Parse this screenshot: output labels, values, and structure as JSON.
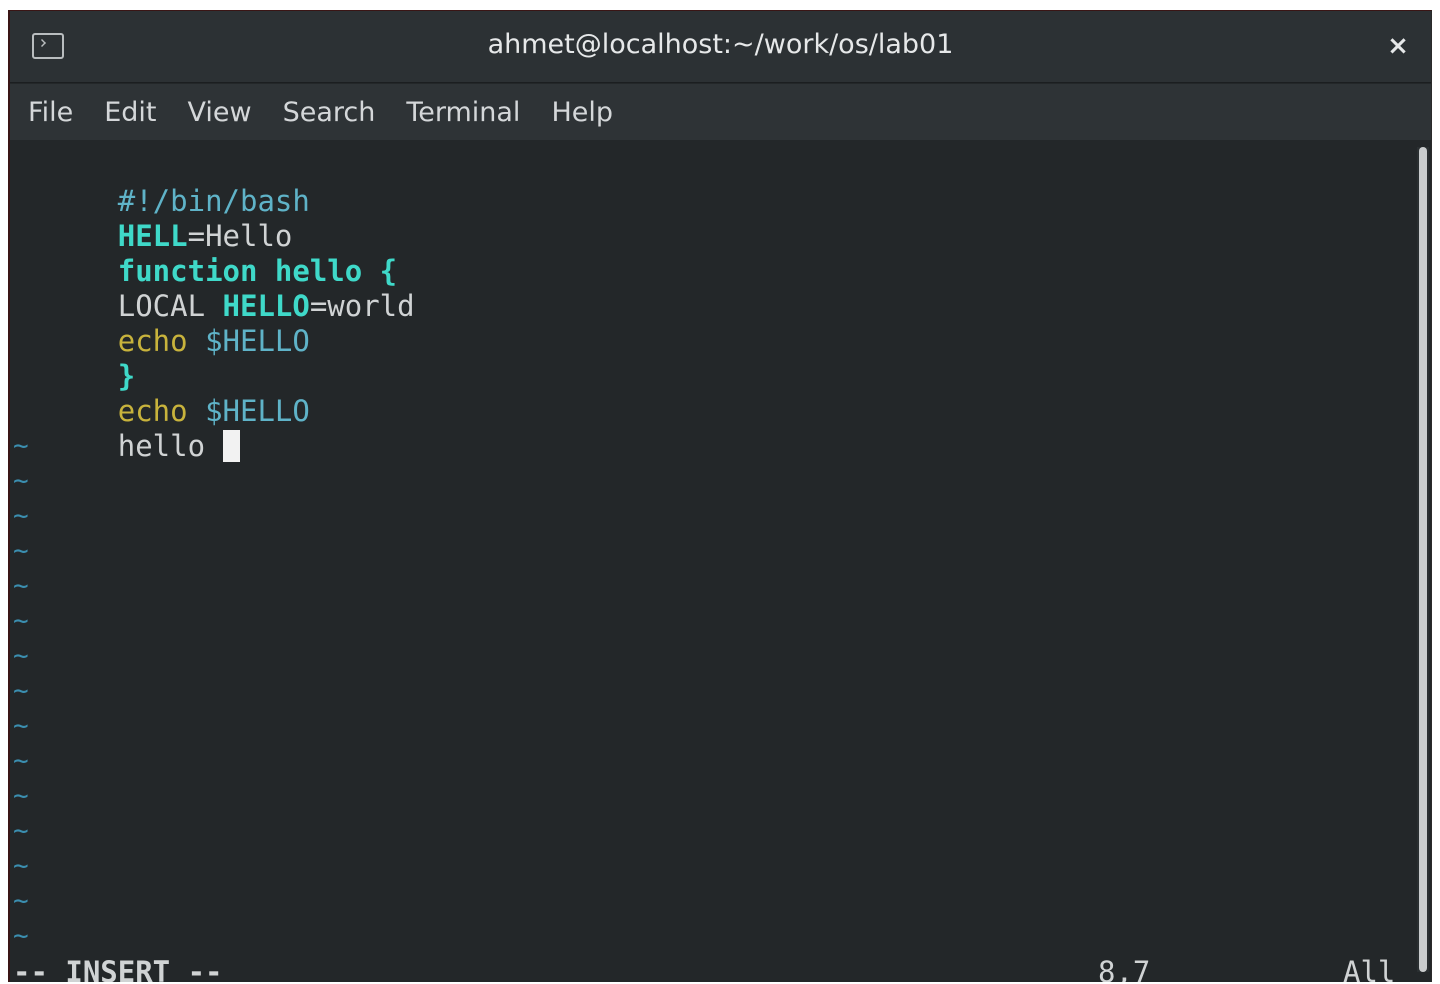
{
  "window": {
    "title": "ahmet@localhost:~/work/os/lab01",
    "close_glyph": "×",
    "icon": "terminal-icon"
  },
  "menu": {
    "items": [
      "File",
      "Edit",
      "View",
      "Search",
      "Terminal",
      "Help"
    ]
  },
  "editor": {
    "lines": [
      [
        {
          "text": "#!/bin/bash",
          "style": "comment"
        }
      ],
      [
        {
          "text": "HELL",
          "style": "ident"
        },
        {
          "text": "=Hello",
          "style": "plain"
        }
      ],
      [
        {
          "text": "function hello {",
          "style": "keyword"
        }
      ],
      [
        {
          "text": "LOCAL ",
          "style": "plain"
        },
        {
          "text": "HELLO",
          "style": "ident"
        },
        {
          "text": "=world",
          "style": "plain"
        }
      ],
      [
        {
          "text": "echo",
          "style": "builtin"
        },
        {
          "text": " $HELLO",
          "style": "var"
        }
      ],
      [
        {
          "text": "}",
          "style": "keyword"
        }
      ],
      [
        {
          "text": "echo",
          "style": "builtin"
        },
        {
          "text": " $HELLO",
          "style": "var"
        }
      ],
      [
        {
          "text": "hello ",
          "style": "plain"
        }
      ]
    ],
    "tilde": "~",
    "tilde_count": 15,
    "mode": "-- INSERT --",
    "position": "8,7",
    "scroll": "All"
  },
  "colors": {
    "background": "#232729",
    "comment": "#5fb3c8",
    "identifier": "#3fd9c9",
    "builtin": "#c8b33c",
    "tilde": "#3b8fb0"
  }
}
